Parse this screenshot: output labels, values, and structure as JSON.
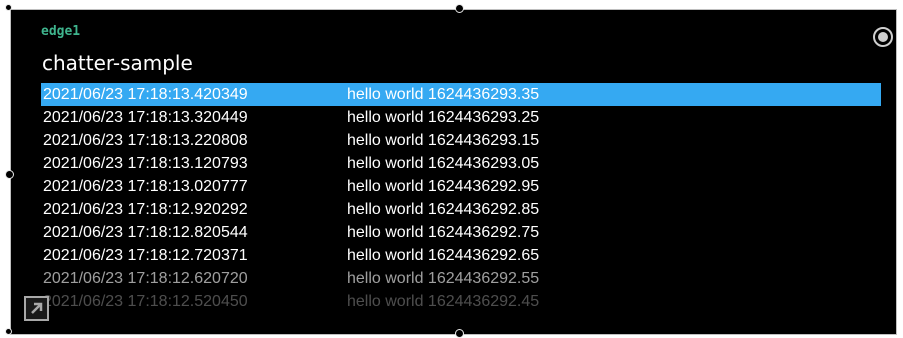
{
  "node": {
    "label": "edge1"
  },
  "panel": {
    "title": "chatter-sample"
  },
  "log": {
    "rows": [
      {
        "timestamp": "2021/06/23 17:18:13.420349",
        "message": "hello world 1624436293.35"
      },
      {
        "timestamp": "2021/06/23 17:18:13.320449",
        "message": "hello world 1624436293.25"
      },
      {
        "timestamp": "2021/06/23 17:18:13.220808",
        "message": "hello world 1624436293.15"
      },
      {
        "timestamp": "2021/06/23 17:18:13.120793",
        "message": "hello world 1624436293.05"
      },
      {
        "timestamp": "2021/06/23 17:18:13.020777",
        "message": "hello world 1624436292.95"
      },
      {
        "timestamp": "2021/06/23 17:18:12.920292",
        "message": "hello world 1624436292.85"
      },
      {
        "timestamp": "2021/06/23 17:18:12.820544",
        "message": "hello world 1624436292.75"
      },
      {
        "timestamp": "2021/06/23 17:18:12.720371",
        "message": "hello world 1624436292.65"
      },
      {
        "timestamp": "2021/06/23 17:18:12.620720",
        "message": "hello world 1624436292.55"
      },
      {
        "timestamp": "2021/06/23 17:18:12.520450",
        "message": "hello world 1624436292.45"
      }
    ],
    "selected_index": 0
  },
  "colors": {
    "background": "#000000",
    "node_label": "#3fb58e",
    "selection": "#35a9f2",
    "text": "#ffffff"
  },
  "icons": {
    "settings": "radio-target-icon",
    "expand": "expand-arrow-icon"
  }
}
